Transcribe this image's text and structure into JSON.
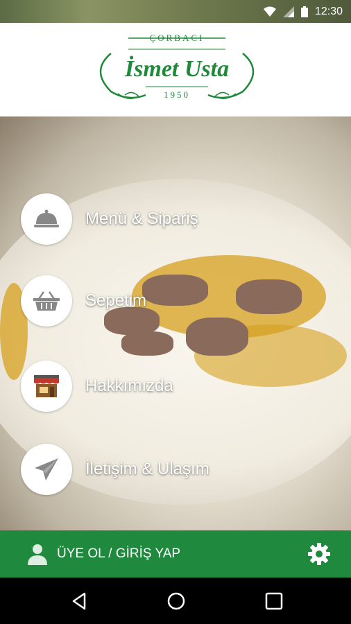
{
  "status_bar": {
    "time": "12:30",
    "icons": [
      "wifi-icon",
      "signal-icon",
      "battery-icon"
    ]
  },
  "logo": {
    "top_text": "ÇORBACI",
    "name": "İsmet Usta",
    "year": "1950",
    "color": "#1e8a3a"
  },
  "menu": {
    "items": [
      {
        "label": "Menü & Sipariş",
        "icon": "cloche-icon"
      },
      {
        "label": "Sepetim",
        "icon": "basket-icon"
      },
      {
        "label": "Hakkımızda",
        "icon": "storefront-icon"
      },
      {
        "label": "İletişim & Ulaşım",
        "icon": "paper-plane-icon"
      }
    ]
  },
  "bottom_bar": {
    "login_label": "ÜYE OL / GİRİŞ YAP",
    "user_icon": "user-icon",
    "settings_icon": "gear-icon",
    "color": "#1f8a3d"
  },
  "nav_bar": {
    "buttons": [
      "back-icon",
      "home-icon",
      "recents-icon"
    ]
  }
}
